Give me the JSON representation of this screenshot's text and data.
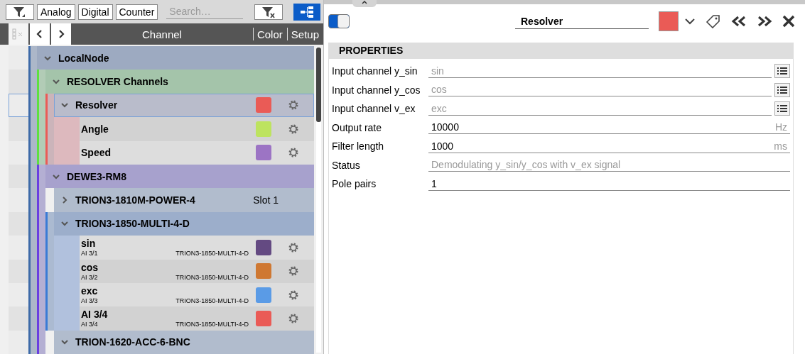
{
  "toolbar": {
    "filter_buttons": [
      {
        "label": "Analog"
      },
      {
        "label": "Digital"
      },
      {
        "label": "Counter"
      }
    ],
    "search": {
      "placeholder": "Search…"
    },
    "tree_view": {
      "on": true
    }
  },
  "header": {
    "columns": [
      "Channel",
      "Color",
      "Setup"
    ]
  },
  "tree": [
    {
      "kind": "group",
      "label": "LocalNode",
      "color": "#3d6aa8",
      "expanded": true,
      "selected": false,
      "children": [
        {
          "kind": "group",
          "label": "RESOLVER Channels",
          "color": "#5ee040",
          "expanded": true,
          "selected": false,
          "children": [
            {
              "kind": "math",
              "label": "Resolver",
              "color": "#ea5b56",
              "expanded": true,
              "selected": true,
              "children": [
                {
                  "kind": "channel",
                  "label": "Angle",
                  "color": "#bde35f",
                  "selected": false
                },
                {
                  "kind": "channel",
                  "label": "Speed",
                  "color": "#9c74c4",
                  "selected": false
                }
              ]
            }
          ]
        },
        {
          "kind": "group",
          "label": "DEWE3-RM8",
          "color": "#6a3fe0",
          "expanded": true,
          "selected": false,
          "children": [
            {
              "kind": "module",
              "label": "TRION3-1810M-POWER-4",
              "slot": "Slot 1",
              "expanded": false,
              "selected": false
            },
            {
              "kind": "group",
              "label": "TRION3-1850-MULTI-4-D",
              "color": "#3a7bd5",
              "expanded": true,
              "selected": false,
              "children": [
                {
                  "kind": "channel",
                  "label": "sin",
                  "sublabel": "AI 3/1",
                  "device": "TRION3-1850-MULTI-4-D",
                  "color": "#644a82",
                  "selected": false
                },
                {
                  "kind": "channel",
                  "label": "cos",
                  "sublabel": "AI 3/2",
                  "device": "TRION3-1850-MULTI-4-D",
                  "color": "#cf7832",
                  "selected": false
                },
                {
                  "kind": "channel",
                  "label": "exc",
                  "sublabel": "AI 3/3",
                  "device": "TRION3-1850-MULTI-4-D",
                  "color": "#5a9be6",
                  "selected": false
                },
                {
                  "kind": "channel",
                  "label": "AI 3/4",
                  "sublabel": "AI 3/4",
                  "device": "TRION3-1850-MULTI-4-D",
                  "color": "#ea5b56",
                  "selected": false
                }
              ]
            },
            {
              "kind": "module",
              "label": "TRION-1620-ACC-6-BNC",
              "expanded": true,
              "selected": false
            }
          ]
        }
      ]
    }
  ],
  "editor": {
    "enabled": true,
    "name": "Resolver",
    "color": "#ea5b56",
    "section": "PROPERTIES",
    "properties": [
      {
        "kind": "channel",
        "label": "Input channel y_sin",
        "value": "sin",
        "readonly": true
      },
      {
        "kind": "channel",
        "label": "Input channel y_cos",
        "value": "cos",
        "readonly": true
      },
      {
        "kind": "channel",
        "label": "Input channel v_ex",
        "value": "exc",
        "readonly": true
      },
      {
        "kind": "number",
        "label": "Output rate",
        "value": "10000",
        "unit": "Hz",
        "readonly": false
      },
      {
        "kind": "number",
        "label": "Filter length",
        "value": "1000",
        "unit": "ms",
        "readonly": false
      },
      {
        "kind": "text",
        "label": "Status",
        "value": "Demodulating y_sin/y_cos with v_ex signal",
        "readonly": true
      },
      {
        "kind": "number",
        "label": "Pole pairs",
        "value": "1",
        "readonly": false
      }
    ]
  }
}
